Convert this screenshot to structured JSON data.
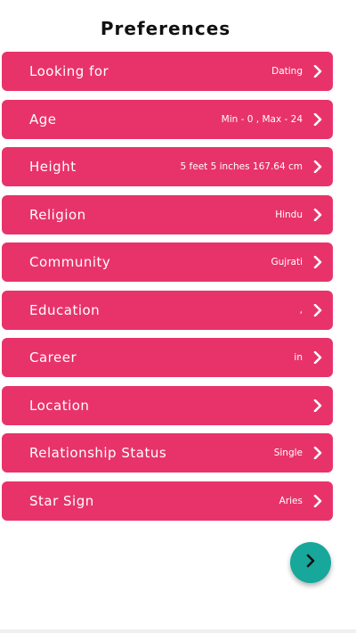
{
  "header": {
    "title": "Preferences"
  },
  "rows": [
    {
      "label": "Looking for",
      "value": "Dating"
    },
    {
      "label": "Age",
      "value": "Min - 0 ,  Max - 24"
    },
    {
      "label": "Height",
      "value": "5 feet 5 inches 167.64 cm"
    },
    {
      "label": "Religion",
      "value": "Hindu"
    },
    {
      "label": "Community",
      "value": "Gujrati"
    },
    {
      "label": "Education",
      "value": ","
    },
    {
      "label": "Career",
      "value": "in"
    },
    {
      "label": "Location",
      "value": ""
    },
    {
      "label": "Relationship Status",
      "value": "Single"
    },
    {
      "label": "Star Sign",
      "value": "Aries"
    }
  ],
  "colors": {
    "row_background": "#e8336a",
    "fab_background": "#17a79b",
    "text_on_accent": "#ffffff"
  },
  "icons": {
    "row_chevron": "chevron-right-icon",
    "next": "chevron-right-icon"
  }
}
